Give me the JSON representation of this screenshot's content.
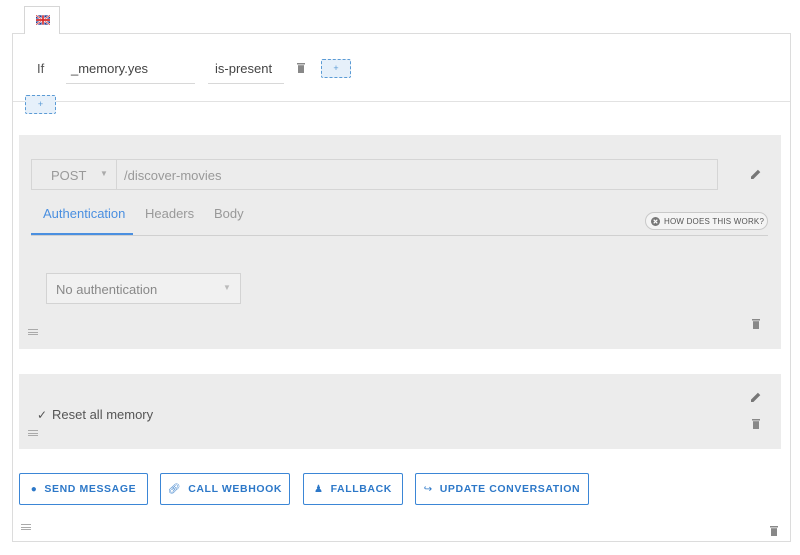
{
  "language": {
    "icon": "uk-flag-icon"
  },
  "condition": {
    "if_label": "If",
    "variable": "_memory.yes",
    "operator": "is-present",
    "add_inline": "+",
    "add_condition": "+"
  },
  "webhook": {
    "method": "POST",
    "url": "/discover-movies",
    "tabs": [
      "Authentication",
      "Headers",
      "Body"
    ],
    "active_tab": "Authentication",
    "help_label": "HOW DOES THIS WORK?",
    "auth_value": "No authentication"
  },
  "reset": {
    "label": "Reset all memory"
  },
  "actions": {
    "send_message": "SEND MESSAGE",
    "call_webhook": "CALL WEBHOOK",
    "fallback": "FALLBACK",
    "update_conversation": "UPDATE CONVERSATION"
  },
  "colors": {
    "accent": "#2d78c8",
    "panel": "#ececec",
    "tab_active": "#4a8fe0"
  }
}
